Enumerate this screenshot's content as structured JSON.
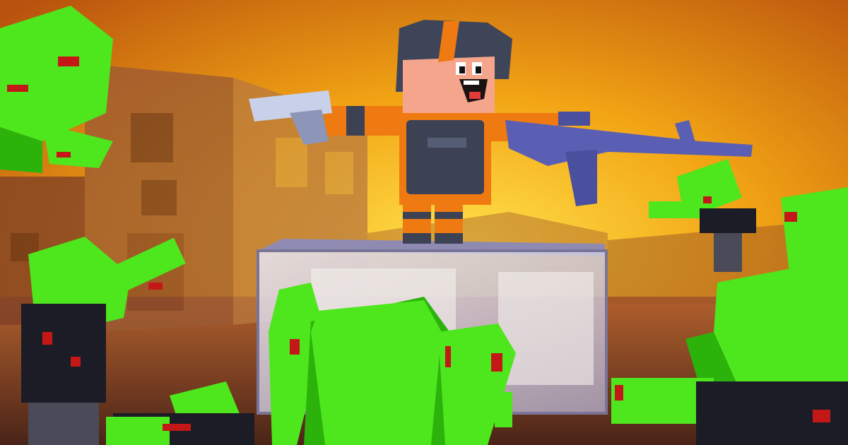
{
  "scene": {
    "sky_top": "#b8520e",
    "sky_mid": "#f2a414",
    "sky_glow": "#ffe14a",
    "ground": "#6e3b26",
    "zombie_skin": "#4ee61c",
    "zombie_skin_dark": "#2bb30c",
    "zombie_shirt": "#1b1c26",
    "zombie_pants": "#4a4a58",
    "blood": "#c41818",
    "hero_helmet": "#3f4559",
    "hero_stripe": "#f07a12",
    "hero_vest": "#3c4254",
    "hero_skin": "#f5a58b",
    "rifle": "#5a5fb4",
    "pistol": "#c9d0ea",
    "glass_box": "#c9c6de"
  }
}
